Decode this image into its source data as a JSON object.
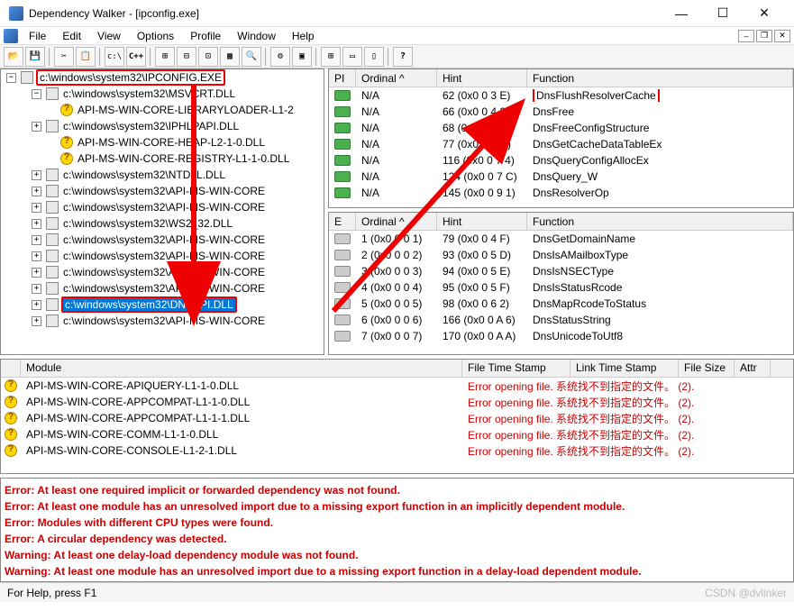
{
  "window": {
    "title": "Dependency Walker - [ipconfig.exe]"
  },
  "menu": {
    "file": "File",
    "edit": "Edit",
    "view": "View",
    "options": "Options",
    "profile": "Profile",
    "window": "Window",
    "help": "Help"
  },
  "toolbar_buttons": [
    "open",
    "save",
    "|",
    "cut",
    "copy",
    "paste",
    "|",
    "c:\\",
    "C++",
    "|",
    "t1",
    "t2",
    "t3",
    "t4",
    "t5",
    "|",
    "p1",
    "p2",
    "|",
    "a1",
    "a2",
    "a3",
    "a4",
    "|",
    "help"
  ],
  "tree": {
    "root": "c:\\windows\\system32\\IPCONFIG.EXE",
    "items": [
      {
        "indent": 1,
        "exp": "-",
        "icon": "mod",
        "label": "c:\\windows\\system32\\MSVCRT.DLL"
      },
      {
        "indent": 2,
        "exp": "",
        "icon": "q",
        "label": "API-MS-WIN-CORE-LIBRARYLOADER-L1-2"
      },
      {
        "indent": 1,
        "exp": "+",
        "icon": "mod",
        "label": "c:\\windows\\system32\\IPHLPAPI.DLL"
      },
      {
        "indent": 2,
        "exp": "",
        "icon": "q",
        "label": "API-MS-WIN-CORE-HEAP-L2-1-0.DLL"
      },
      {
        "indent": 2,
        "exp": "",
        "icon": "q",
        "label": "API-MS-WIN-CORE-REGISTRY-L1-1-0.DLL"
      },
      {
        "indent": 1,
        "exp": "+",
        "icon": "mod",
        "label": "c:\\windows\\system32\\NTDLL.DLL"
      },
      {
        "indent": 1,
        "exp": "+",
        "icon": "mod",
        "label": "c:\\windows\\system32\\API-MS-WIN-CORE"
      },
      {
        "indent": 1,
        "exp": "+",
        "icon": "mod",
        "label": "c:\\windows\\system32\\API-MS-WIN-CORE"
      },
      {
        "indent": 1,
        "exp": "+",
        "icon": "mod",
        "label": "c:\\windows\\system32\\WS2_32.DLL"
      },
      {
        "indent": 1,
        "exp": "+",
        "icon": "mod",
        "label": "c:\\windows\\system32\\API-MS-WIN-CORE"
      },
      {
        "indent": 1,
        "exp": "+",
        "icon": "mod",
        "label": "c:\\windows\\system32\\API-MS-WIN-CORE"
      },
      {
        "indent": 1,
        "exp": "+",
        "icon": "mod",
        "label": "c:\\windows\\system32\\API-MS-WIN-CORE"
      },
      {
        "indent": 1,
        "exp": "+",
        "icon": "mod",
        "label": "c:\\windows\\system32\\API-MS-WIN-CORE"
      },
      {
        "indent": 1,
        "exp": "+",
        "icon": "mod",
        "label": "c:\\windows\\system32\\DNSAPI.DLL",
        "sel": true,
        "boxed": true
      },
      {
        "indent": 1,
        "exp": "+",
        "icon": "mod",
        "label": "c:\\windows\\system32\\API-MS-WIN-CORE"
      }
    ]
  },
  "imports": {
    "headers": {
      "pi": "PI",
      "ordinal": "Ordinal ^",
      "hint": "Hint",
      "function": "Function"
    },
    "rows": [
      {
        "pi": "green",
        "ord": "N/A",
        "hint": "62 (0x0 0 3 E)",
        "fn": "DnsFlushResolverCache",
        "boxed": true
      },
      {
        "pi": "green",
        "ord": "N/A",
        "hint": "66 (0x0 0 4 2)",
        "fn": "DnsFree"
      },
      {
        "pi": "green",
        "ord": "N/A",
        "hint": "68 (0x0 0 4 4)",
        "fn": "DnsFreeConfigStructure"
      },
      {
        "pi": "green",
        "ord": "N/A",
        "hint": "77 (0x0 0 4 D)",
        "fn": "DnsGetCacheDataTableEx"
      },
      {
        "pi": "green",
        "ord": "N/A",
        "hint": "116 (0x0 0 7 4)",
        "fn": "DnsQueryConfigAllocEx"
      },
      {
        "pi": "green",
        "ord": "N/A",
        "hint": "124 (0x0 0 7 C)",
        "fn": "DnsQuery_W"
      },
      {
        "pi": "green",
        "ord": "N/A",
        "hint": "145 (0x0 0 9 1)",
        "fn": "DnsResolverOp"
      }
    ]
  },
  "exports": {
    "headers": {
      "e": "E",
      "ordinal": "Ordinal ^",
      "hint": "Hint",
      "function": "Function"
    },
    "rows": [
      {
        "e": "gray",
        "ord": "1 (0x0 0 0 1)",
        "hint": "79 (0x0 0 4 F)",
        "fn": "DnsGetDomainName"
      },
      {
        "e": "gray",
        "ord": "2 (0x0 0 0 2)",
        "hint": "93 (0x0 0 5 D)",
        "fn": "DnsIsAMailboxType"
      },
      {
        "e": "gray",
        "ord": "3 (0x0 0 0 3)",
        "hint": "94 (0x0 0 5 E)",
        "fn": "DnsIsNSECType"
      },
      {
        "e": "gray",
        "ord": "4 (0x0 0 0 4)",
        "hint": "95 (0x0 0 5 F)",
        "fn": "DnsIsStatusRcode"
      },
      {
        "e": "gray",
        "ord": "5 (0x0 0 0 5)",
        "hint": "98 (0x0 0 6 2)",
        "fn": "DnsMapRcodeToStatus"
      },
      {
        "e": "gray",
        "ord": "6 (0x0 0 0 6)",
        "hint": "166 (0x0 0 A 6)",
        "fn": "DnsStatusString"
      },
      {
        "e": "gray",
        "ord": "7 (0x0 0 0 7)",
        "hint": "170 (0x0 0 A A)",
        "fn": "DnsUnicodeToUtf8"
      }
    ]
  },
  "modules": {
    "headers": {
      "icon": "",
      "module": "Module",
      "fts": "File Time Stamp",
      "lts": "Link Time Stamp",
      "fs": "File Size",
      "attr": "Attr"
    },
    "error_msg": "Error opening file. 系统找不到指定的文件。 (2).",
    "rows": [
      "API-MS-WIN-CORE-APIQUERY-L1-1-0.DLL",
      "API-MS-WIN-CORE-APPCOMPAT-L1-1-0.DLL",
      "API-MS-WIN-CORE-APPCOMPAT-L1-1-1.DLL",
      "API-MS-WIN-CORE-COMM-L1-1-0.DLL",
      "API-MS-WIN-CORE-CONSOLE-L1-2-1.DLL"
    ]
  },
  "log": [
    "Error: At least one required implicit or forwarded dependency was not found.",
    "Error: At least one module has an unresolved import due to a missing export function in an implicitly dependent module.",
    "Error: Modules with different CPU types were found.",
    "Error: A circular dependency was detected.",
    "Warning: At least one delay-load dependency module was not found.",
    "Warning: At least one module has an unresolved import due to a missing export function in a delay-load dependent module."
  ],
  "status": {
    "text": "For Help, press F1",
    "watermark": "CSDN @dvlinker"
  }
}
